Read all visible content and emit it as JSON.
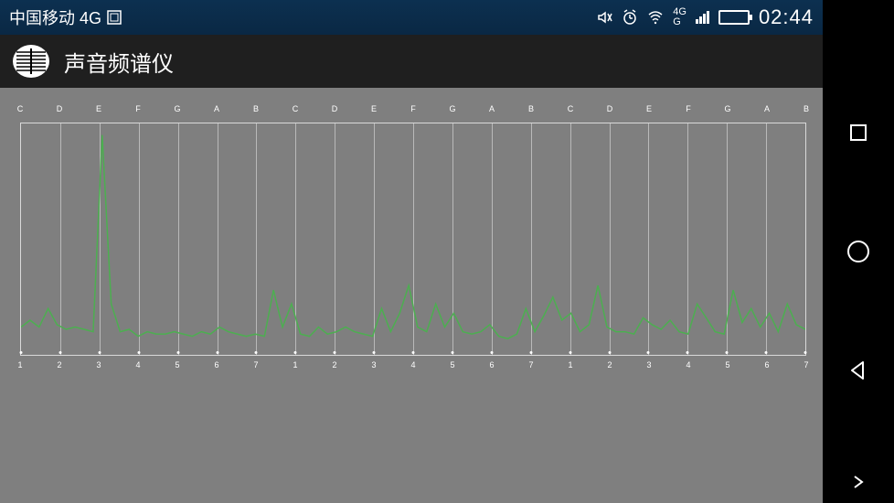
{
  "statusbar": {
    "carrier": "中国移动 4G",
    "net_label_top": "4G",
    "net_label_bot": "G",
    "time": "02:44"
  },
  "appbar": {
    "title": "声音频谱仪"
  },
  "chart_data": {
    "type": "line",
    "title": "",
    "xlabel": "",
    "ylabel": "",
    "ylim": [
      0,
      1
    ],
    "note_labels": [
      "C",
      "D",
      "E",
      "F",
      "G",
      "A",
      "B",
      "C",
      "D",
      "E",
      "F",
      "G",
      "A",
      "B",
      "C",
      "D",
      "E",
      "F",
      "G",
      "A",
      "B"
    ],
    "x_ticks": [
      "1",
      "2",
      "3",
      "4",
      "5",
      "6",
      "7",
      "1",
      "2",
      "3",
      "4",
      "5",
      "6",
      "7",
      "1",
      "2",
      "3",
      "4",
      "5",
      "6",
      "7"
    ],
    "values": [
      0.12,
      0.15,
      0.12,
      0.2,
      0.13,
      0.11,
      0.12,
      0.11,
      0.1,
      0.95,
      0.22,
      0.1,
      0.11,
      0.08,
      0.1,
      0.09,
      0.09,
      0.1,
      0.09,
      0.08,
      0.1,
      0.09,
      0.12,
      0.1,
      0.09,
      0.08,
      0.09,
      0.08,
      0.28,
      0.12,
      0.22,
      0.09,
      0.08,
      0.12,
      0.09,
      0.1,
      0.12,
      0.1,
      0.09,
      0.08,
      0.2,
      0.1,
      0.18,
      0.3,
      0.12,
      0.1,
      0.22,
      0.12,
      0.18,
      0.1,
      0.09,
      0.1,
      0.13,
      0.08,
      0.07,
      0.09,
      0.2,
      0.1,
      0.17,
      0.25,
      0.15,
      0.18,
      0.1,
      0.13,
      0.3,
      0.12,
      0.1,
      0.1,
      0.09,
      0.16,
      0.13,
      0.11,
      0.15,
      0.1,
      0.09,
      0.22,
      0.16,
      0.1,
      0.09,
      0.28,
      0.14,
      0.2,
      0.12,
      0.18,
      0.1,
      0.22,
      0.13,
      0.11
    ]
  },
  "colors": {
    "spectrum": "#4caf50"
  }
}
